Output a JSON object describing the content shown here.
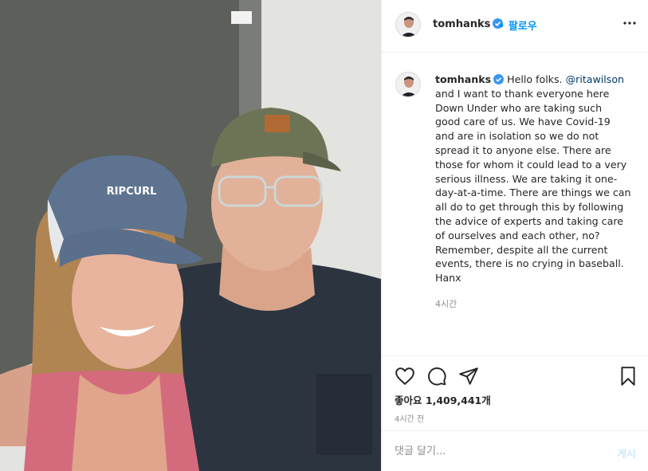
{
  "post": {
    "username": "tomhanks",
    "follow_separator": "•",
    "follow_label": "팔로우",
    "caption": {
      "username": "tomhanks",
      "mention": "@ritawilson",
      "lines_before_mention": "Hello folks.",
      "lines_after_mention": [
        "and I want to thank everyone here",
        "Down Under who are taking such",
        "good care of us. We have Covid-19",
        "and are in isolation so we do not",
        "spread it to anyone else. There are",
        "those for whom it could lead to a very",
        "serious illness. We are taking it one-",
        "day-at-a-time. There are things we can",
        "all do to get through this by following",
        "the advice of experts and taking care",
        "of ourselves and each other, no?",
        "Remember, despite all the current",
        "events, there is no crying in baseball.",
        "Hanx"
      ],
      "time_ago": "4시간"
    },
    "photo": {
      "cap_text": "RIPCURL"
    },
    "likes_label": "좋아요",
    "likes_count": "1,409,441개",
    "post_time": "4시간 전",
    "comment": {
      "placeholder": "댓글 달기...",
      "post_label": "게시"
    }
  },
  "colors": {
    "verified": "#3897f0",
    "link": "#0095f6",
    "mention": "#00376b",
    "muted": "#8e8e8e"
  },
  "icons": [
    "more-icon",
    "verified-icon",
    "heart-icon",
    "comment-icon",
    "share-icon",
    "bookmark-icon"
  ]
}
